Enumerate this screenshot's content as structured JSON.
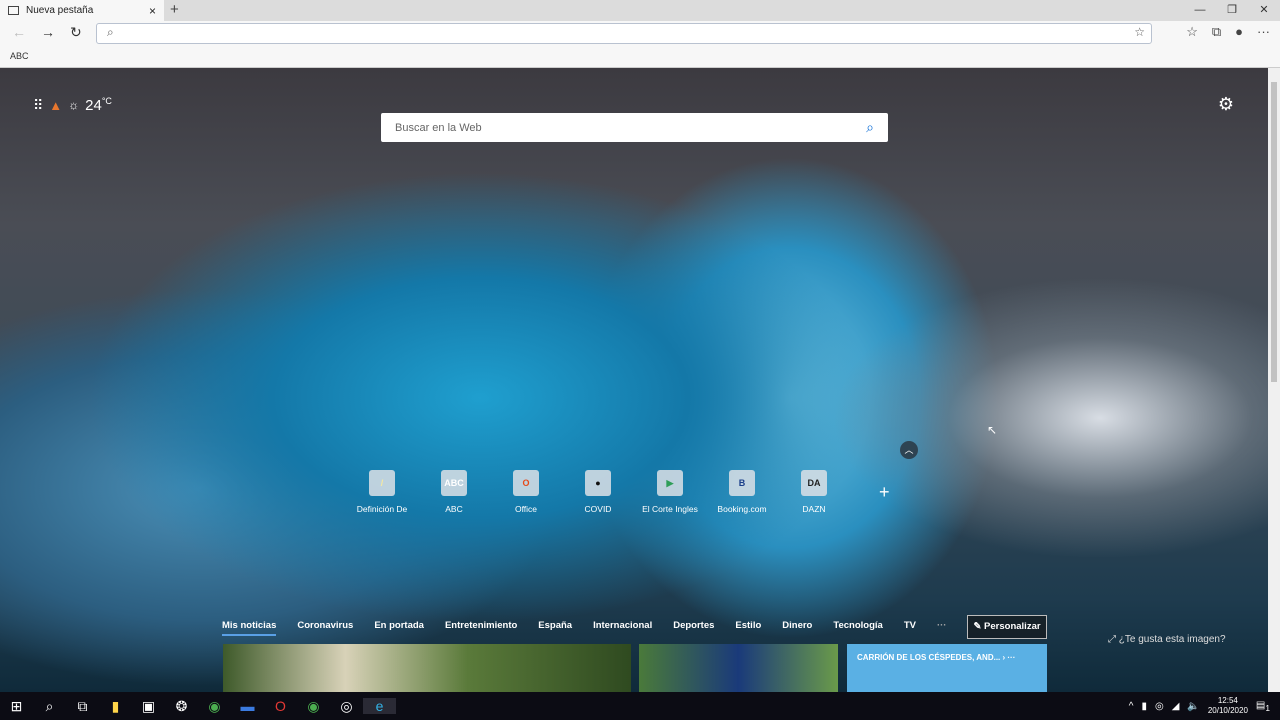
{
  "browser": {
    "tab_title": "Nueva pestaña",
    "new_tab": "+",
    "close": "×",
    "minimize": "—",
    "restore": "❐",
    "close_window": "✕",
    "address_value": "",
    "favorites": [
      {
        "label": "ABC"
      }
    ]
  },
  "weather": {
    "temperature": "24",
    "unit": "°C"
  },
  "search": {
    "placeholder": "Buscar en la Web"
  },
  "quick_links": [
    {
      "label": "Definición De",
      "icon": "/"
    },
    {
      "label": "ABC",
      "icon": "ABC"
    },
    {
      "label": "Office",
      "icon": "O"
    },
    {
      "label": "COVID",
      "icon": "●"
    },
    {
      "label": "El Corte Ingles",
      "icon": "▶"
    },
    {
      "label": "Booking.com",
      "icon": "B"
    },
    {
      "label": "DAZN",
      "icon": "DA"
    }
  ],
  "news": {
    "tabs": [
      "Mis noticias",
      "Coronavirus",
      "En portada",
      "Entretenimiento",
      "España",
      "Internacional",
      "Deportes",
      "Estilo",
      "Dinero",
      "Tecnología",
      "TV"
    ],
    "more": "···",
    "customize": "Personalizar",
    "like_image": "¿Te gusta esta imagen?",
    "card3_title": "CARRIÓN DE LOS CÉSPEDES, AND...  ›  ···"
  },
  "taskbar": {
    "time": "12:54",
    "date": "20/10/2020",
    "notifications": "1"
  }
}
